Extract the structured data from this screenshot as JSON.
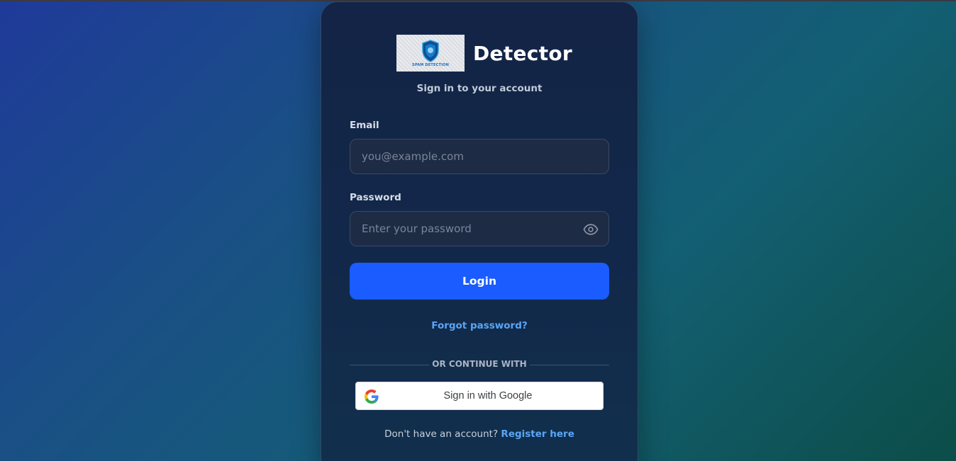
{
  "brand": {
    "name": "Detector",
    "logo_text": "SPAM DETECTION",
    "logo_icon": "shield-icon"
  },
  "subtitle": "Sign in to your account",
  "email": {
    "label": "Email",
    "placeholder": "you@example.com",
    "value": ""
  },
  "password": {
    "label": "Password",
    "placeholder": "Enter your password",
    "value": "",
    "toggle_icon": "eye-icon"
  },
  "login_label": "Login",
  "forgot_label": "Forgot password?",
  "divider_text": "OR CONTINUE WITH",
  "google_label": "Sign in with Google",
  "register": {
    "prompt": "Don't have an account?",
    "link": "Register here"
  },
  "colors": {
    "accent": "#1a5cff",
    "link": "#5aa6f5",
    "card_bg": "#132446"
  }
}
